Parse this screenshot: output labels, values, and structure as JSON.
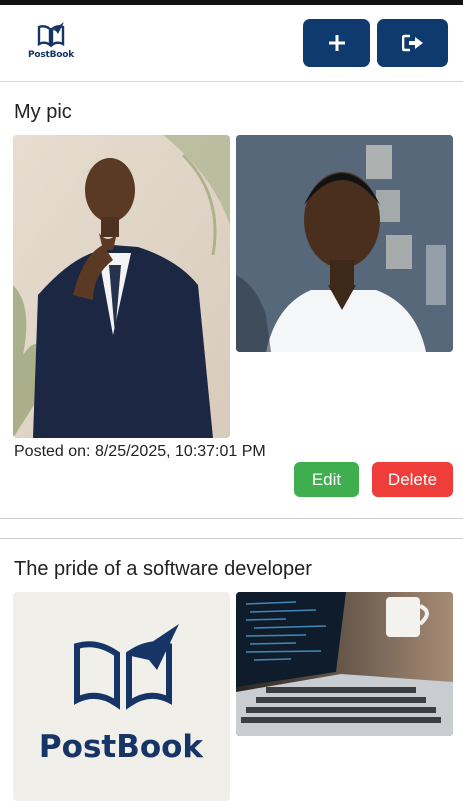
{
  "header": {
    "logo_text": "PostBook",
    "add_button_icon": "plus-icon",
    "logout_button_icon": "logout-icon",
    "button_color": "#0f3a6e"
  },
  "posts": [
    {
      "title": "My pic",
      "images": [
        "photo of a young man in a navy suit, hand on chin, palm leaves background",
        "photo of a smiling young man in a white shirt, blue patterned wall behind"
      ],
      "posted_on": "Posted on: 8/25/2025, 10:37:01 PM",
      "edit_label": "Edit",
      "delete_label": "Delete"
    },
    {
      "title": "The pride of a software developer",
      "images": [
        "PostBook logo: open book with paper plane",
        "laptop keyboard with code on screen and a mug"
      ],
      "logo_text": "PostBook"
    }
  ],
  "colors": {
    "edit": "#3fae4e",
    "delete": "#ef3e3a",
    "brand": "#163466"
  }
}
